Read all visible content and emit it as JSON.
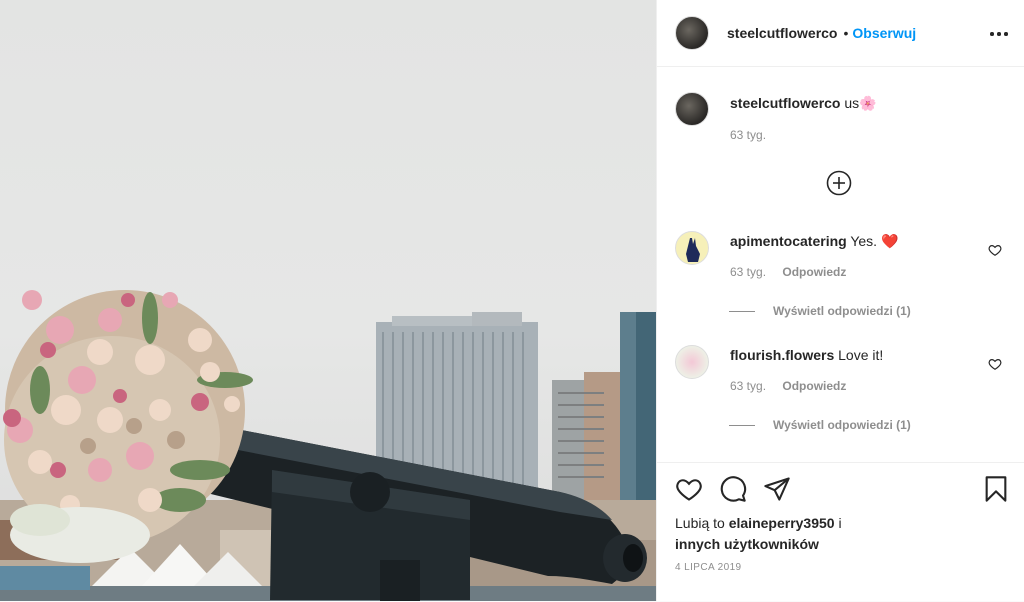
{
  "post": {
    "username": "steelcutflowerco",
    "dot": "•",
    "follow_label": "Obserwuj",
    "caption_text": "us",
    "caption_emoji": "🌸",
    "caption_time": "63 tyg."
  },
  "comments": [
    {
      "username": "apimentocatering",
      "text": "Yes.",
      "emoji": "❤️",
      "time": "63 tyg.",
      "reply_label": "Odpowiedz",
      "view_replies": "Wyświetl odpowiedzi (1)"
    },
    {
      "username": "flourish.flowers",
      "text": "Love it!",
      "time": "63 tyg.",
      "reply_label": "Odpowiedz",
      "view_replies": "Wyświetl odpowiedzi (1)"
    }
  ],
  "likes": {
    "prefix": "Lubią to",
    "user": "elaineperry3950",
    "conj": "i",
    "others": "innych użytkowników"
  },
  "date": "4 LIPCA 2019",
  "colors": {
    "link": "#0095f6",
    "muted": "#8e8e8e",
    "heart": "#ed4956"
  },
  "icons": [
    "more-icon",
    "load-more-icon",
    "heart-icon",
    "comment-icon",
    "share-icon",
    "bookmark-icon"
  ]
}
